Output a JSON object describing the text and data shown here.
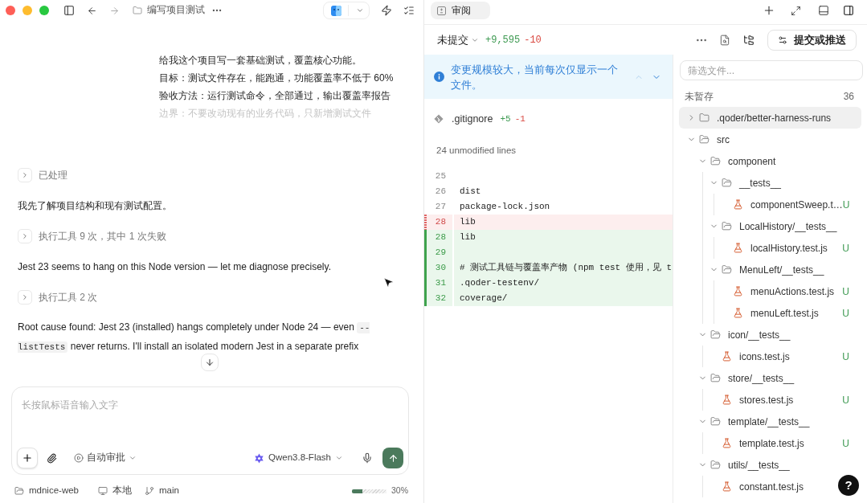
{
  "window": {
    "title": "编写项目测试",
    "help_button": "?"
  },
  "conversation": {
    "user_message": [
      {
        "text": "给我这个项目写一套基础测试，覆盖核心功能。",
        "faded": false
      },
      {
        "text": "目标：测试文件存在，能跑通，功能覆盖率不低于 60%",
        "faded": false
      },
      {
        "text": "验收方法：运行测试命令，全部通过，输出覆盖率报告",
        "faded": false
      },
      {
        "text": "边界：不要改动现有的业务代码，只新增测试文件",
        "faded": true
      }
    ],
    "items": [
      {
        "kind": "step",
        "label": "已处理",
        "expanded": false
      },
      {
        "kind": "text",
        "text": "我先了解项目结构和现有测试配置。"
      },
      {
        "kind": "step",
        "label": "执行工具 9 次，其中 1 次失败",
        "expanded": false
      },
      {
        "kind": "text",
        "text": "Jest 23 seems to hang on this Node version — let me diagnose precisely."
      },
      {
        "kind": "step",
        "label": "执行工具 2 次",
        "expanded": false
      },
      {
        "kind": "rich",
        "segments": [
          {
            "kind": "text",
            "text": "Root cause found: Jest 23 (installed) hangs completely under Node 24 — even "
          },
          {
            "kind": "code",
            "text": "--listTests"
          },
          {
            "kind": "text",
            "text": " never returns. I'll install an isolated modern Jest in a separate prefix"
          }
        ]
      }
    ]
  },
  "composer": {
    "placeholder": "长按鼠标语音输入文字",
    "approval_mode": "自动审批",
    "model": "Qwen3.8-Flash"
  },
  "status_bar": {
    "project": "mdnice-web",
    "location": "本地",
    "branch": "main",
    "context": {
      "level": 0.3,
      "reading": "30%"
    }
  },
  "review": {
    "tabs": [
      {
        "label": "审阅",
        "selected": true
      }
    ],
    "scope": "未提交",
    "additions": "+9,595",
    "deletions": "-10",
    "commit_button": "提交或推送",
    "notice": {
      "text": "变更规模较大，当前每次仅显示一个文件。",
      "previous_disabled": true,
      "next_disabled": false
    },
    "file": {
      "name": ".gitignore",
      "additions": "+5",
      "deletions": "-1"
    },
    "unmodified": "24 unmodified lines",
    "lines": [
      {
        "number": "25",
        "kind": "context"
      },
      {
        "number": "26",
        "kind": "context",
        "text": "dist"
      },
      {
        "number": "27",
        "kind": "context",
        "text": "package-lock.json"
      },
      {
        "number": "28",
        "kind": "deleted",
        "text": "lib"
      },
      {
        "number": "28",
        "kind": "added",
        "text": "lib"
      },
      {
        "number": "29",
        "kind": "added"
      },
      {
        "number": "30",
        "kind": "added",
        "text": "# 测试工具链与覆盖率产物 (npm test 使用，见 t"
      },
      {
        "number": "31",
        "kind": "added",
        "text": ".qoder-testenv/"
      },
      {
        "number": "32",
        "kind": "added",
        "text": "coverage/"
      }
    ],
    "filter": {
      "placeholder": "筛选文件..."
    },
    "section": {
      "title": "未暂存",
      "count": "36"
    },
    "tree": [
      {
        "kind": "folder",
        "name": ".qoder/better-harness-runs",
        "expanded": false,
        "selected": true
      },
      {
        "kind": "folder",
        "name": "src",
        "expanded": true,
        "selected": false,
        "children": [
          {
            "kind": "folder",
            "name": "component",
            "expanded": true,
            "selected": false,
            "children": [
              {
                "kind": "folder",
                "name": "__tests__",
                "expanded": true,
                "selected": false,
                "children": [
                  {
                    "kind": "file",
                    "name": "componentSweep.t…",
                    "status": "U",
                    "selected": false
                  }
                ]
              },
              {
                "kind": "folder",
                "name": "LocalHistory/__tests__",
                "expanded": true,
                "selected": false,
                "children": [
                  {
                    "kind": "file",
                    "name": "localHistory.test.js",
                    "status": "U",
                    "selected": false
                  }
                ]
              },
              {
                "kind": "folder",
                "name": "MenuLeft/__tests__",
                "expanded": true,
                "selected": false,
                "children": [
                  {
                    "kind": "file",
                    "name": "menuActions.test.js",
                    "status": "U",
                    "selected": false
                  },
                  {
                    "kind": "file",
                    "name": "menuLeft.test.js",
                    "status": "U",
                    "selected": false
                  }
                ]
              }
            ]
          },
          {
            "kind": "folder",
            "name": "icon/__tests__",
            "expanded": true,
            "selected": false,
            "children": [
              {
                "kind": "file",
                "name": "icons.test.js",
                "status": "U",
                "selected": false
              }
            ]
          },
          {
            "kind": "folder",
            "name": "store/__tests__",
            "expanded": true,
            "selected": false,
            "children": [
              {
                "kind": "file",
                "name": "stores.test.js",
                "status": "U",
                "selected": false
              }
            ]
          },
          {
            "kind": "folder",
            "name": "template/__tests__",
            "expanded": true,
            "selected": false,
            "children": [
              {
                "kind": "file",
                "name": "template.test.js",
                "status": "U",
                "selected": false
              }
            ]
          },
          {
            "kind": "folder",
            "name": "utils/__tests__",
            "expanded": true,
            "selected": false,
            "children": [
              {
                "kind": "file",
                "name": "constant.test.js",
                "selected": false
              }
            ]
          }
        ]
      }
    ]
  }
}
